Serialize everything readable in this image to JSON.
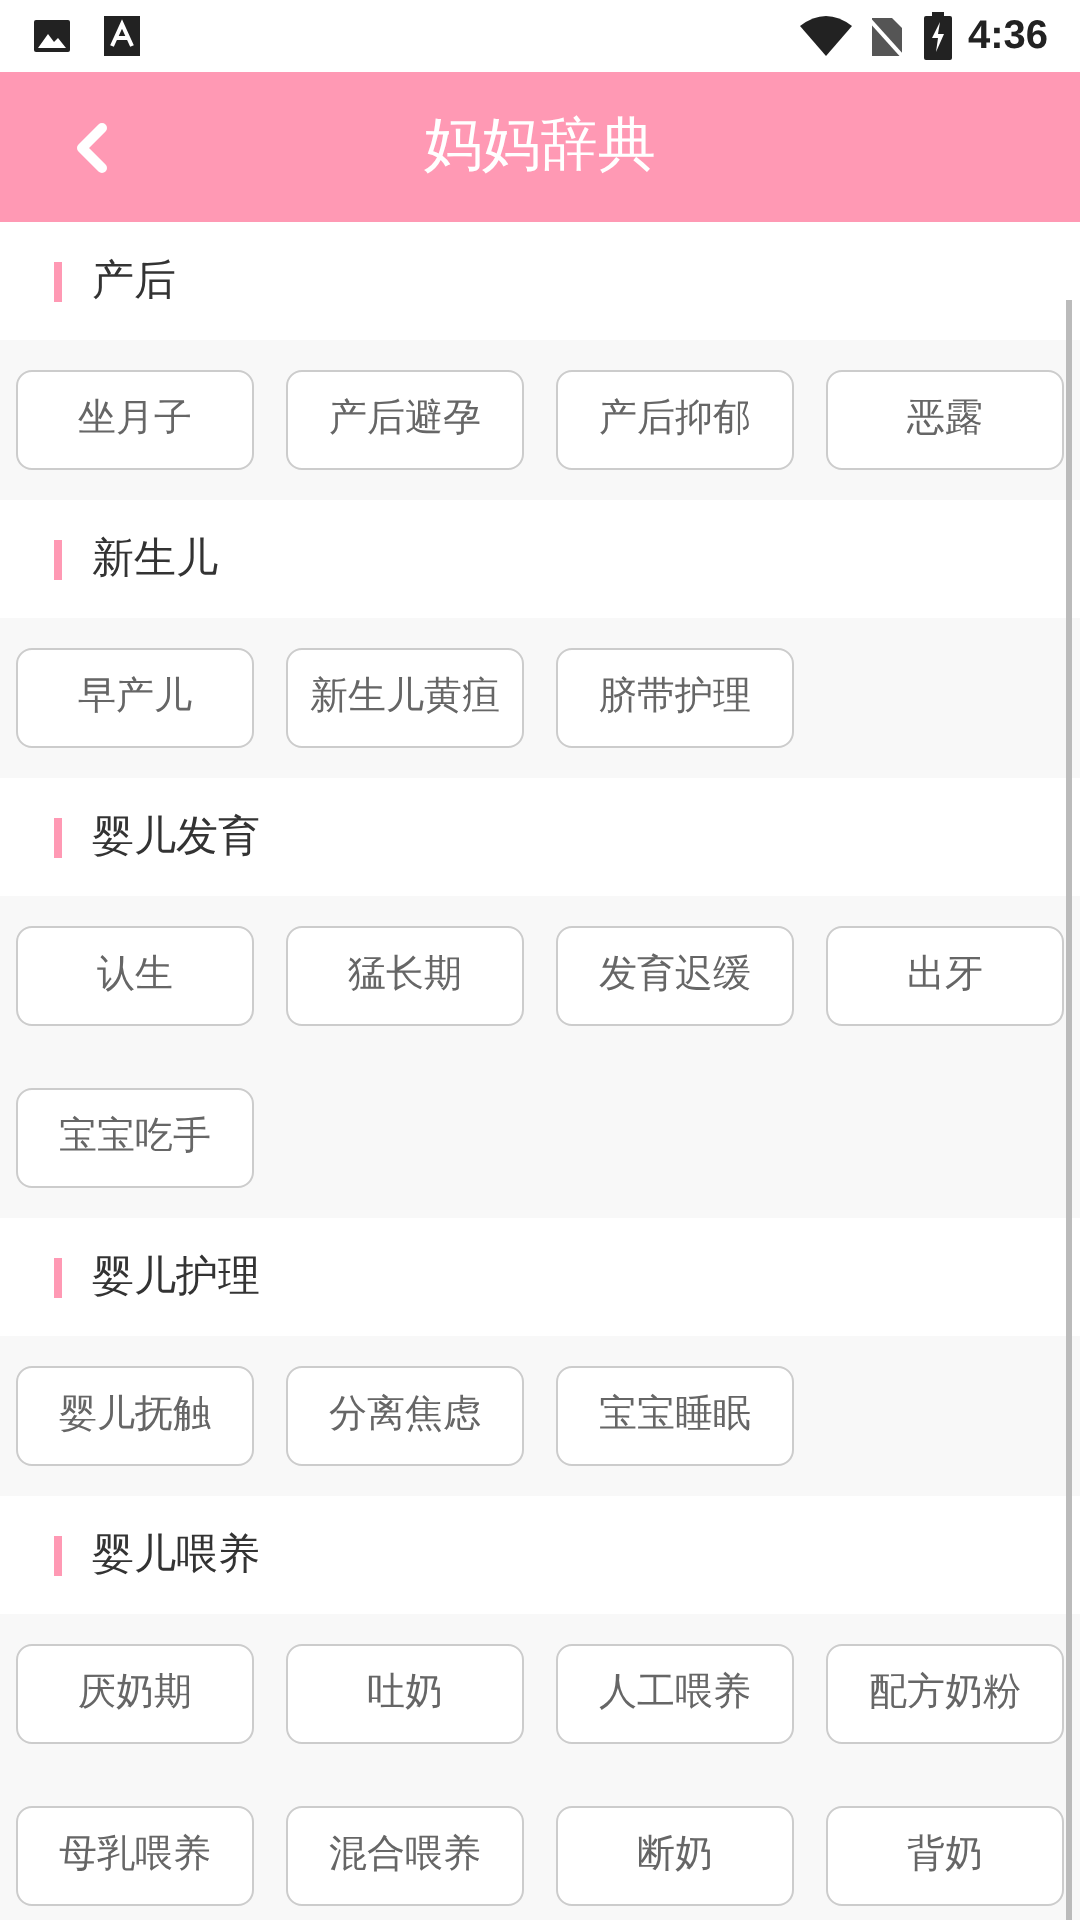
{
  "status_bar": {
    "time": "4:36"
  },
  "header": {
    "title": "妈妈辞典"
  },
  "sections": [
    {
      "title": "产后",
      "tags": [
        "坐月子",
        "产后避孕",
        "产后抑郁",
        "恶露"
      ]
    },
    {
      "title": "新生儿",
      "tags": [
        "早产儿",
        "新生儿黄疸",
        "脐带护理"
      ]
    },
    {
      "title": "婴儿发育",
      "tags": [
        "认生",
        "猛长期",
        "发育迟缓",
        "出牙",
        "宝宝吃手"
      ]
    },
    {
      "title": "婴儿护理",
      "tags": [
        "婴儿抚触",
        "分离焦虑",
        "宝宝睡眠"
      ]
    },
    {
      "title": "婴儿喂养",
      "tags": [
        "厌奶期",
        "吐奶",
        "人工喂养",
        "配方奶粉",
        "母乳喂养",
        "混合喂养",
        "断奶",
        "背奶"
      ]
    }
  ]
}
